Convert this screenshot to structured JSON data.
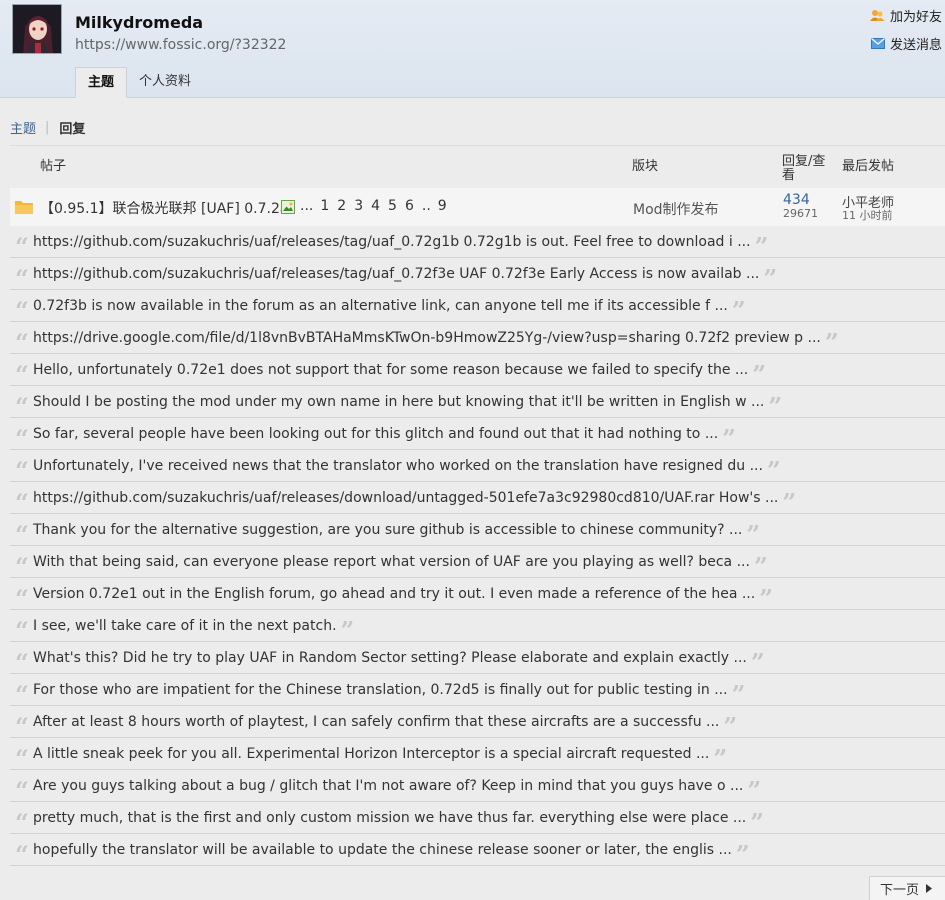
{
  "profile": {
    "username": "Milkydromeda",
    "url": "https://www.fossic.org/?32322",
    "add_friend": "加为好友",
    "send_message": "发送消息"
  },
  "tabs": [
    {
      "label": "主题",
      "active": true
    },
    {
      "label": "个人资料",
      "active": false
    }
  ],
  "subnav": {
    "topics": "主题",
    "separator": "|",
    "replies": "回复"
  },
  "table_headers": {
    "post": "帖子",
    "forum": "版块",
    "stats": "回复/查看",
    "last_post": "最后发帖"
  },
  "thread": {
    "title": "【0.95.1】联合极光联邦 [UAF] 0.7.2a",
    "pages": [
      "...",
      "1",
      "2",
      "3",
      "4",
      "5",
      "6",
      "..",
      "9"
    ],
    "forum": "Mod制作发布",
    "replies": "434",
    "views": "29671",
    "last_user": "小平老师",
    "last_time": "11 小时前"
  },
  "replies": [
    "https://github.com/suzakuchris/uaf/releases/tag/uaf_0.72g1b 0.72g1b is out. Feel free to download i ...",
    "https://github.com/suzakuchris/uaf/releases/tag/uaf_0.72f3e UAF 0.72f3e Early Access is now availab ...",
    "0.72f3b is now available in the forum as an alternative link, can anyone tell me if its accessible f ...",
    "https://drive.google.com/file/d/1l8vnBvBTAHaMmsKTwOn-b9HmowZ25Yg-/view?usp=sharing 0.72f2 preview p ...",
    "Hello, unfortunately 0.72e1 does not support that for some reason because we failed to specify the ...",
    "Should I be posting the mod under my own name in here but knowing that it'll be written in English w ...",
    "So far, several people have been looking out for this glitch and found out that it had nothing to ...",
    "Unfortunately, I've received news that the translator who worked on the translation have resigned du ...",
    "https://github.com/suzakuchris/uaf/releases/download/untagged-501efe7a3c92980cd810/UAF.rar How's ...",
    "Thank you for the alternative suggestion, are you sure github is accessible to chinese community? ...",
    "With that being said, can everyone please report what version of UAF are you playing as well? beca ...",
    "Version 0.72e1 out in the English forum, go ahead and try it out. I even made a reference of the hea ...",
    "I see, we'll take care of it in the next patch.",
    "What's this? Did he try to play UAF in Random Sector setting? Please elaborate and explain exactly ...",
    "For those who are impatient for the Chinese translation, 0.72d5 is finally out for public testing in ...",
    "After at least 8 hours worth of playtest, I can safely confirm that these aircrafts are a successfu ...",
    "A little sneak peek for you all. Experimental Horizon Interceptor is a special aircraft requested ...",
    "Are you guys talking about a bug / glitch that I'm not aware of? Keep in mind that you guys have o ...",
    "pretty much, that is the first and only custom mission we have thus far. everything else were place ...",
    "hopefully the translator will be available to update the chinese release sooner or later, the englis ..."
  ],
  "pagination": {
    "next": "下一页"
  },
  "colors": {
    "link_blue": "#336699",
    "header_bg": "#dbe4ef",
    "page_bg": "#ececec",
    "divider": "#c8d4e2",
    "folder": "#f5b833"
  }
}
